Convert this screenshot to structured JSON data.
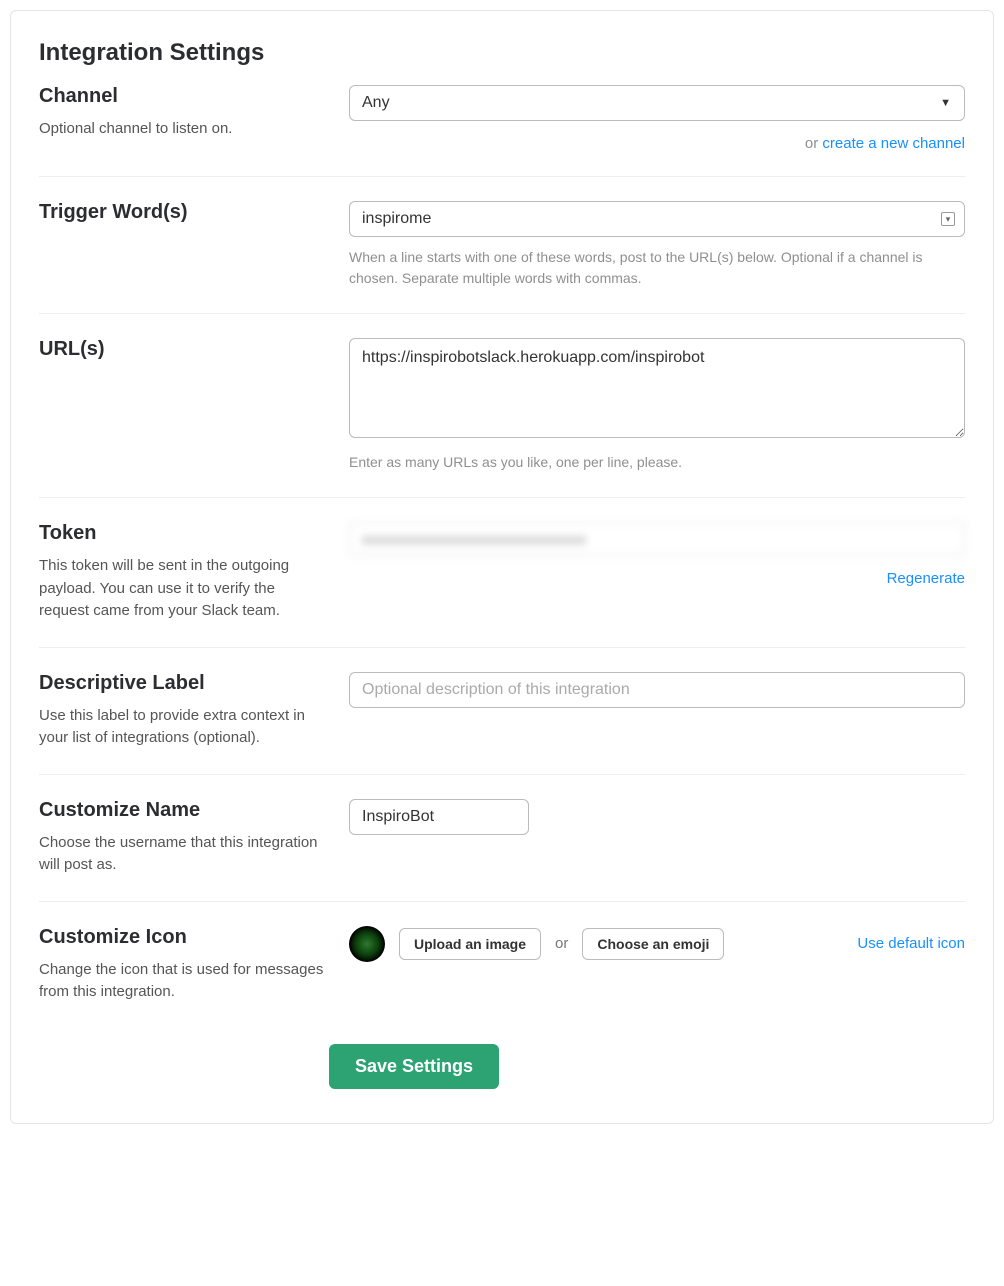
{
  "page_title": "Integration Settings",
  "channel": {
    "heading": "Channel",
    "desc": "Optional channel to listen on.",
    "selected": "Any",
    "or_text": "or ",
    "create_link": "create a new channel"
  },
  "trigger": {
    "heading": "Trigger Word(s)",
    "value": "inspirome",
    "helper": "When a line starts with one of these words, post to the URL(s) below. Optional if a channel is chosen. Separate multiple words with commas."
  },
  "urls": {
    "heading": "URL(s)",
    "value": "https://inspirobotslack.herokuapp.com/inspirobot",
    "helper": "Enter as many URLs as you like, one per line, please."
  },
  "token": {
    "heading": "Token",
    "desc": "This token will be sent in the outgoing payload. You can use it to verify the request came from your Slack team.",
    "value_obfuscated": "xxxxxxxxxxxxxxxxxxxxxxxxxxxxxxxx",
    "regenerate": "Regenerate"
  },
  "label": {
    "heading": "Descriptive Label",
    "desc": "Use this label to provide extra context in your list of integrations (optional).",
    "placeholder": "Optional description of this integration"
  },
  "name": {
    "heading": "Customize Name",
    "desc": "Choose the username that this integration will post as.",
    "value": "InspiroBot"
  },
  "icon": {
    "heading": "Customize Icon",
    "desc": "Change the icon that is used for messages from this integration.",
    "upload": "Upload an image",
    "or": "or",
    "emoji": "Choose an emoji",
    "use_default": "Use default icon"
  },
  "save_button": "Save Settings"
}
